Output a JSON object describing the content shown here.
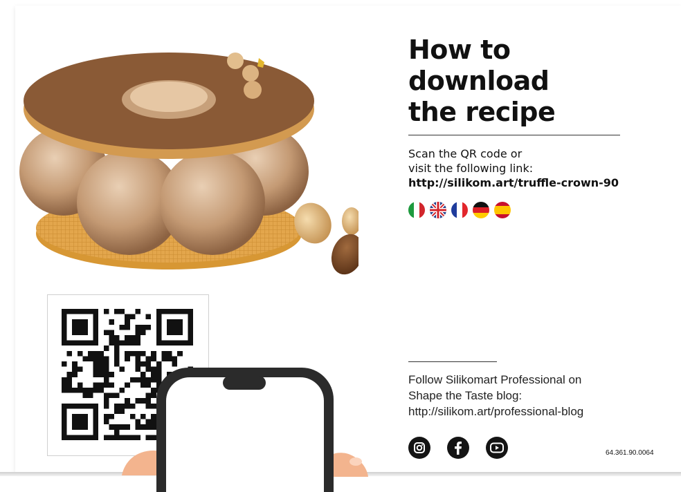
{
  "header": {
    "title_lines": [
      "How to",
      "download",
      "the recipe"
    ]
  },
  "instructions": {
    "line1": "Scan the QR code or",
    "line2": "visit the following link:",
    "link": "http://silikom.art/truffle-crown-90"
  },
  "languages": [
    {
      "name": "it-flag-icon"
    },
    {
      "name": "uk-flag-icon"
    },
    {
      "name": "fr-flag-icon"
    },
    {
      "name": "de-flag-icon"
    },
    {
      "name": "es-flag-icon"
    }
  ],
  "follow": {
    "line1": "Follow Silikomart Professional on",
    "line2": "Shape the Taste blog:",
    "line3": "http://silikom.art/professional-blog"
  },
  "social": [
    "instagram-icon",
    "facebook-icon",
    "youtube-icon"
  ],
  "product_code": "64.361.90.0064",
  "colors": {
    "cocoa": "#8a5a36",
    "sponge": "#c9a37e",
    "pastry": "#e7b05a",
    "skin": "#f3b48e"
  }
}
